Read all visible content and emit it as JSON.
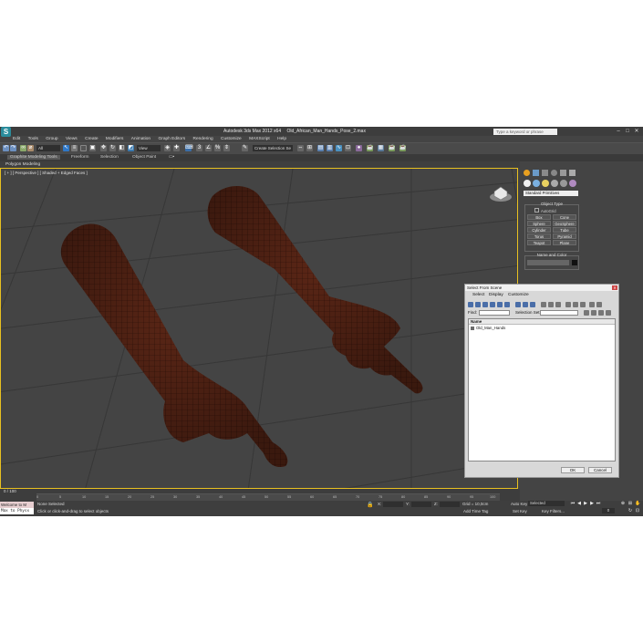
{
  "window": {
    "app_title": "Autodesk 3ds Max 2012 x64",
    "file_name": "Old_African_Man_Hands_Pose_2.max",
    "search_placeholder": "Type a keyword or phrase",
    "logo_text": "S"
  },
  "menu": [
    "Edit",
    "Tools",
    "Group",
    "Views",
    "Create",
    "Modifiers",
    "Animation",
    "Graph Editors",
    "Rendering",
    "Customize",
    "MAXScript",
    "Help"
  ],
  "toolbar": {
    "selection_filter": "All",
    "reference_coord": "View",
    "named_selection": "Create Selection Se"
  },
  "ribbon": {
    "tabs": [
      "Graphite Modeling Tools",
      "Freeform",
      "Selection",
      "Object Paint"
    ],
    "sub_label": "Polygon Modeling"
  },
  "viewport": {
    "label": "[ + ] [ Perspective ] [ Shaded + Edged Faces ]",
    "accent": "#e8c020"
  },
  "command_panel": {
    "category": "Standard Primitives",
    "object_type_title": "Object Type",
    "autogrid_label": "AutoGrid",
    "buttons": [
      "Box",
      "Cone",
      "Sphere",
      "GeoSphere",
      "Cylinder",
      "Tube",
      "Torus",
      "Pyramid",
      "Teapot",
      "Plane"
    ],
    "name_color_title": "Name and Color",
    "color_swatch": "#111111"
  },
  "dialog": {
    "title": "Select From Scene",
    "menu": [
      "Select",
      "Display",
      "Customize"
    ],
    "find_label": "Find:",
    "selection_set_label": "Selection Set:",
    "column_header": "Name",
    "items": [
      "Old_Man_Hands"
    ],
    "ok_label": "OK",
    "cancel_label": "Cancel"
  },
  "timeline": {
    "frame_label": "0 / 100",
    "ticks": [
      "0",
      "5",
      "10",
      "15",
      "20",
      "25",
      "30",
      "35",
      "40",
      "45",
      "50",
      "55",
      "60",
      "65",
      "70",
      "75",
      "80",
      "85",
      "90",
      "95",
      "100"
    ]
  },
  "status": {
    "maxscript_label": "Welcome to M",
    "maxscript_input": "Max to Physx",
    "selected_text": "None Selected",
    "prompt_text": "Click or click-and-drag to select objects",
    "x_label": "X:",
    "y_label": "Y:",
    "z_label": "Z:",
    "grid_text": "Grid = 10,0cm",
    "add_time_tag": "Add Time Tag",
    "auto_key_label": "Auto Key",
    "auto_key_value": "Selected",
    "set_key_label": "Set Key",
    "key_filters_label": "Key Filters...",
    "frame_value": "0"
  }
}
